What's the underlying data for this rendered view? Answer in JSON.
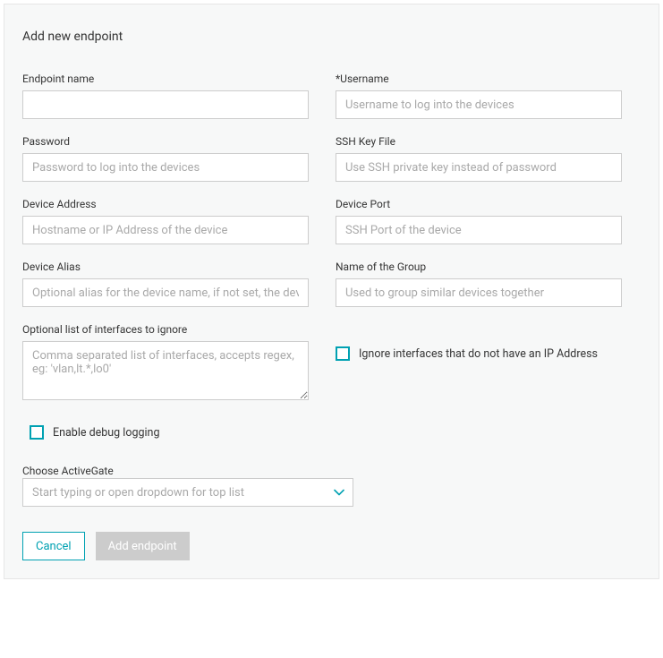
{
  "panel": {
    "title": "Add new endpoint"
  },
  "fields": {
    "endpoint_name": {
      "label": "Endpoint name",
      "placeholder": "",
      "value": ""
    },
    "username": {
      "label": "*Username",
      "placeholder": "Username to log into the devices",
      "value": ""
    },
    "password": {
      "label": "Password",
      "placeholder": "Password to log into the devices",
      "value": ""
    },
    "ssh_key_file": {
      "label": "SSH Key File",
      "placeholder": "Use SSH private key instead of password",
      "value": ""
    },
    "device_address": {
      "label": "Device Address",
      "placeholder": "Hostname or IP Address of the device",
      "value": ""
    },
    "device_port": {
      "label": "Device Port",
      "placeholder": "SSH Port of the device",
      "value": ""
    },
    "device_alias": {
      "label": "Device Alias",
      "placeholder": "Optional alias for the device name, if not set, the device name will be used",
      "value": ""
    },
    "group_name": {
      "label": "Name of the Group",
      "placeholder": "Used to group similar devices together",
      "value": ""
    },
    "ignore_interfaces": {
      "label": "Optional list of interfaces to ignore",
      "placeholder": "Comma separated list of interfaces, accepts regex, eg: 'vlan,lt.*,lo0'",
      "value": ""
    },
    "activegate": {
      "label": "Choose ActiveGate",
      "placeholder": "Start typing or open dropdown for top list"
    }
  },
  "checkboxes": {
    "ignore_no_ip": {
      "label": "Ignore interfaces that do not have an IP Address",
      "checked": false
    },
    "debug_logging": {
      "label": "Enable debug logging",
      "checked": false
    }
  },
  "buttons": {
    "cancel": "Cancel",
    "add_endpoint": "Add endpoint"
  },
  "colors": {
    "accent": "#00a1b2",
    "disabled": "#cccccc",
    "placeholder": "#a9a9a9"
  }
}
